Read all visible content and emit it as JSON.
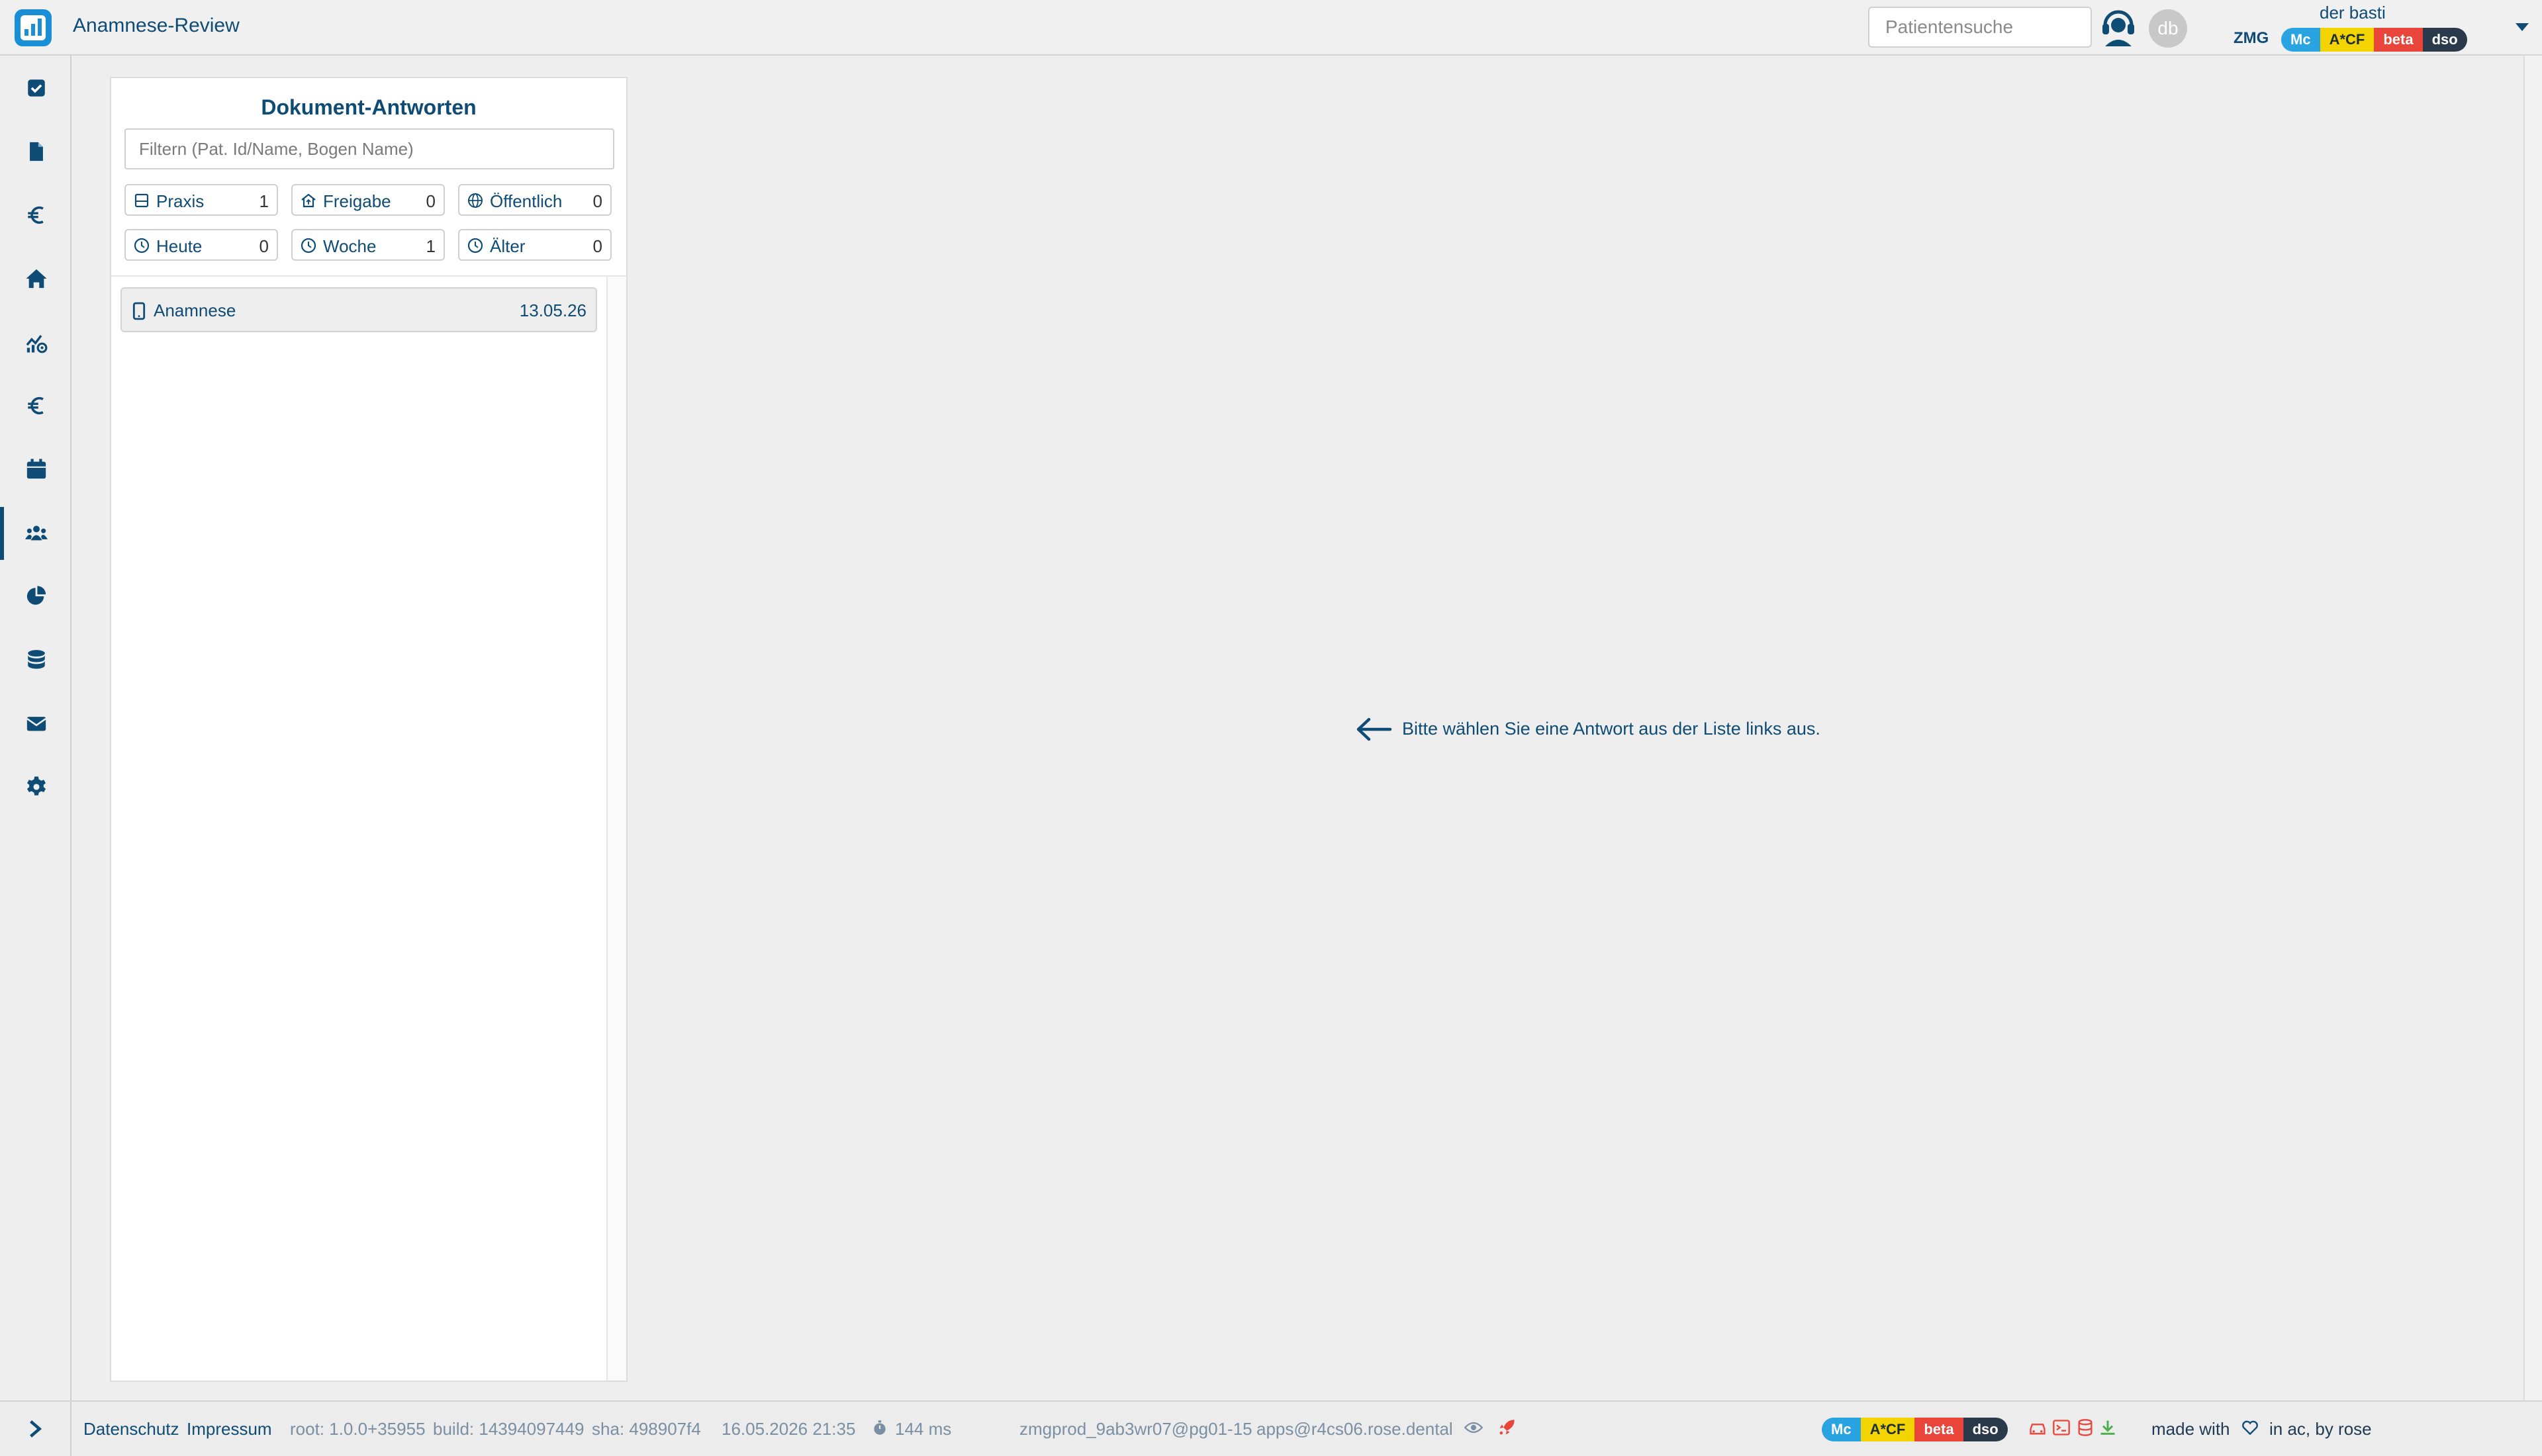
{
  "header": {
    "title": "Anamnese-Review",
    "search_placeholder": "Patientensuche",
    "avatar_initials": "db",
    "user_name": "der basti",
    "org": "ZMG",
    "tags": [
      "Mc",
      "A*CF",
      "beta",
      "dso"
    ]
  },
  "sidebar": {
    "items": [
      {
        "icon": "check-square-icon"
      },
      {
        "icon": "document-icon"
      },
      {
        "icon": "euro-icon"
      },
      {
        "icon": "home-icon"
      },
      {
        "icon": "chart-settings-icon"
      },
      {
        "icon": "euro-icon"
      },
      {
        "icon": "calendar-icon"
      },
      {
        "icon": "users-icon",
        "active": true
      },
      {
        "icon": "pie-chart-icon"
      },
      {
        "icon": "database-icon"
      },
      {
        "icon": "mail-icon"
      },
      {
        "icon": "gear-icon"
      }
    ]
  },
  "panel": {
    "title": "Dokument-Antworten",
    "filter_placeholder": "Filtern (Pat. Id/Name, Bogen Name)",
    "chips": [
      {
        "label": "Praxis",
        "count": "1",
        "icon": "practice-icon"
      },
      {
        "label": "Freigabe",
        "count": "0",
        "icon": "share-icon"
      },
      {
        "label": "Öffentlich",
        "count": "0",
        "icon": "globe-icon"
      },
      {
        "label": "Heute",
        "count": "0",
        "icon": "clock-icon"
      },
      {
        "label": "Woche",
        "count": "1",
        "icon": "clock-icon"
      },
      {
        "label": "Älter",
        "count": "0",
        "icon": "clock-icon"
      }
    ],
    "items": [
      {
        "name": "Anamnese",
        "date": "13.05.26",
        "icon": "tablet-icon"
      }
    ]
  },
  "main": {
    "empty_message": "Bitte wählen Sie eine Antwort aus der Liste links aus."
  },
  "footer": {
    "privacy": "Datenschutz",
    "imprint": "Impressum",
    "root": "root: 1.0.0+35955",
    "build": "build: 14394097449",
    "sha": "sha: 498907f4",
    "datetime": "16.05.2026 21:35",
    "timing": "144 ms",
    "db": "zmgprod_9ab3wr07@pg01-15",
    "host": "apps@r4cs06.rose.dental",
    "made_with": "made with",
    "by": "in ac, by rose",
    "tags": [
      "Mc",
      "A*CF",
      "beta",
      "dso"
    ]
  },
  "colors": {
    "primary": "#0f4c75",
    "accent": "#1a8fd6",
    "tag_mc": "#2aa3e3",
    "tag_acf": "#f4d400",
    "tag_beta": "#e9453a",
    "tag_dso": "#2b3a4a",
    "alert": "#e9453a"
  }
}
